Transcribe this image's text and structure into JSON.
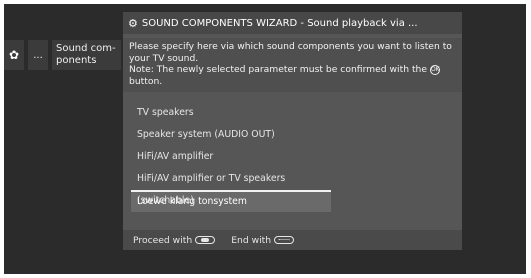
{
  "breadcrumb": {
    "icon": "gear-icon",
    "dots": "...",
    "label": "Sound com- ponents"
  },
  "wizard": {
    "title_icon": "gears-icon",
    "title": "SOUND COMPONENTS WIZARD - Sound playback via ...",
    "desc_line1": "Please specify here via which sound components you want to listen to your TV sound.",
    "desc_line2_before": "Note: The newly selected parameter must be confirmed with the",
    "desc_line2_after": "button.",
    "ok_icon": "ok-button-icon",
    "options": [
      "TV speakers",
      "Speaker system (AUDIO OUT)",
      "HiFi/AV amplifier",
      "HiFi/AV amplifier or TV speakers (switchable)",
      "Loewe klang tonsystem"
    ],
    "selected_index": 4
  },
  "footer": {
    "proceed_label": "Proceed with",
    "proceed_icon": "forward-button-icon",
    "end_label": "End with",
    "end_icon": "end-button-icon"
  }
}
